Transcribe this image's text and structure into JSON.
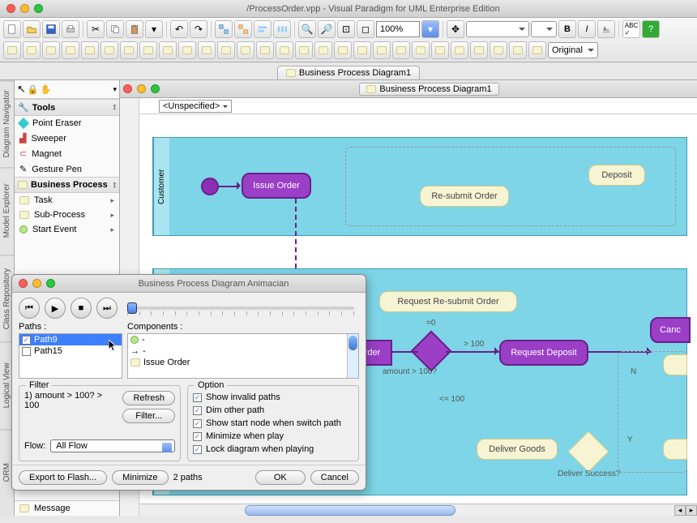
{
  "window": {
    "title": "/ProcessOrder.vpp - Visual Paradigm for UML Enterprise Edition"
  },
  "zoom": "100%",
  "original_combo": "Original",
  "tab_label": "Business Process Diagram1",
  "side_tabs": [
    "Diagram Navigator",
    "Model Explorer",
    "Class Repository",
    "Logical View",
    "ORM"
  ],
  "palette": {
    "toolbar_section": "Tools",
    "tools": [
      "Point Eraser",
      "Sweeper",
      "Magnet",
      "Gesture Pen"
    ],
    "bp_section": "Business Process",
    "bp_items": [
      "Task",
      "Sub-Process",
      "Start Event"
    ],
    "extra": "Message"
  },
  "unspecified": "<Unspecified>",
  "pool1_label": "Customer",
  "nodes": {
    "issue_order": "Issue Order",
    "resubmit": "Re-submit Order",
    "deposit": "Deposit",
    "s_order": "s Order",
    "request_resubmit": "Request Re-submit Order",
    "request_deposit": "Request Deposit",
    "canc": "Canc",
    "deliver_goods": "Deliver Goods",
    "deliver_success": "Deliver Success?",
    "amount_q": "amount > 100?",
    "gt100": "> 100",
    "eq0": "=0",
    "lte100": "<= 100",
    "n": "N",
    "y": "Y"
  },
  "dialog": {
    "title": "Business Process Diagram Animacian",
    "paths_label": "Paths :",
    "components_label": "Components :",
    "paths": [
      {
        "name": "Path9",
        "checked": true,
        "selected": true
      },
      {
        "name": "Path15",
        "checked": false,
        "selected": false
      }
    ],
    "components": [
      {
        "name": "-",
        "icon": "circle"
      },
      {
        "name": "-",
        "icon": "arrow"
      },
      {
        "name": "Issue Order",
        "icon": "task"
      }
    ],
    "filter": {
      "legend": "Filter",
      "rule": "1) amount > 100? > 100",
      "refresh": "Refresh",
      "filter_btn": "Filter...",
      "flow_label": "Flow:",
      "flow_value": "All Flow"
    },
    "option": {
      "legend": "Option",
      "items": [
        "Show invalid paths",
        "Dim other path",
        "Show start node when switch path",
        "Minimize when play",
        "Lock diagram when playing"
      ]
    },
    "footer": {
      "export": "Export to Flash...",
      "minimize": "Minimize",
      "count": "2 paths",
      "ok": "OK",
      "cancel": "Cancel"
    }
  }
}
